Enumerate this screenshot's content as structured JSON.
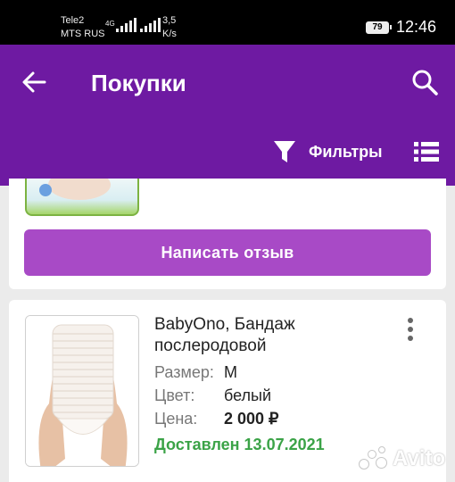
{
  "status_bar": {
    "carrier_1": "Tele2",
    "carrier_2": "MTS RUS",
    "network_type": "4G",
    "speed_value": "3,5",
    "speed_unit": "K/s",
    "battery": "79",
    "time": "12:46"
  },
  "header": {
    "title": "Покупки",
    "filters_label": "Фильтры",
    "bg_color": "#6e1aa2"
  },
  "first_order": {
    "review_button_label": "Написать отзыв",
    "button_color": "#a84ac6"
  },
  "second_order": {
    "product_name": "BabyOno, Бандаж послеродовой",
    "attributes": [
      {
        "label": "Размер:",
        "value": "M"
      },
      {
        "label": "Цвет:",
        "value": "белый"
      },
      {
        "label": "Цена:",
        "value": "2 000 ₽"
      }
    ],
    "status": "Доставлен 13.07.2021",
    "status_color": "#3ba347"
  },
  "watermark": {
    "text": "Avito"
  },
  "icons": [
    "arrow-left-icon",
    "search-icon",
    "filter-icon",
    "list-view-icon",
    "more-vertical-icon"
  ]
}
